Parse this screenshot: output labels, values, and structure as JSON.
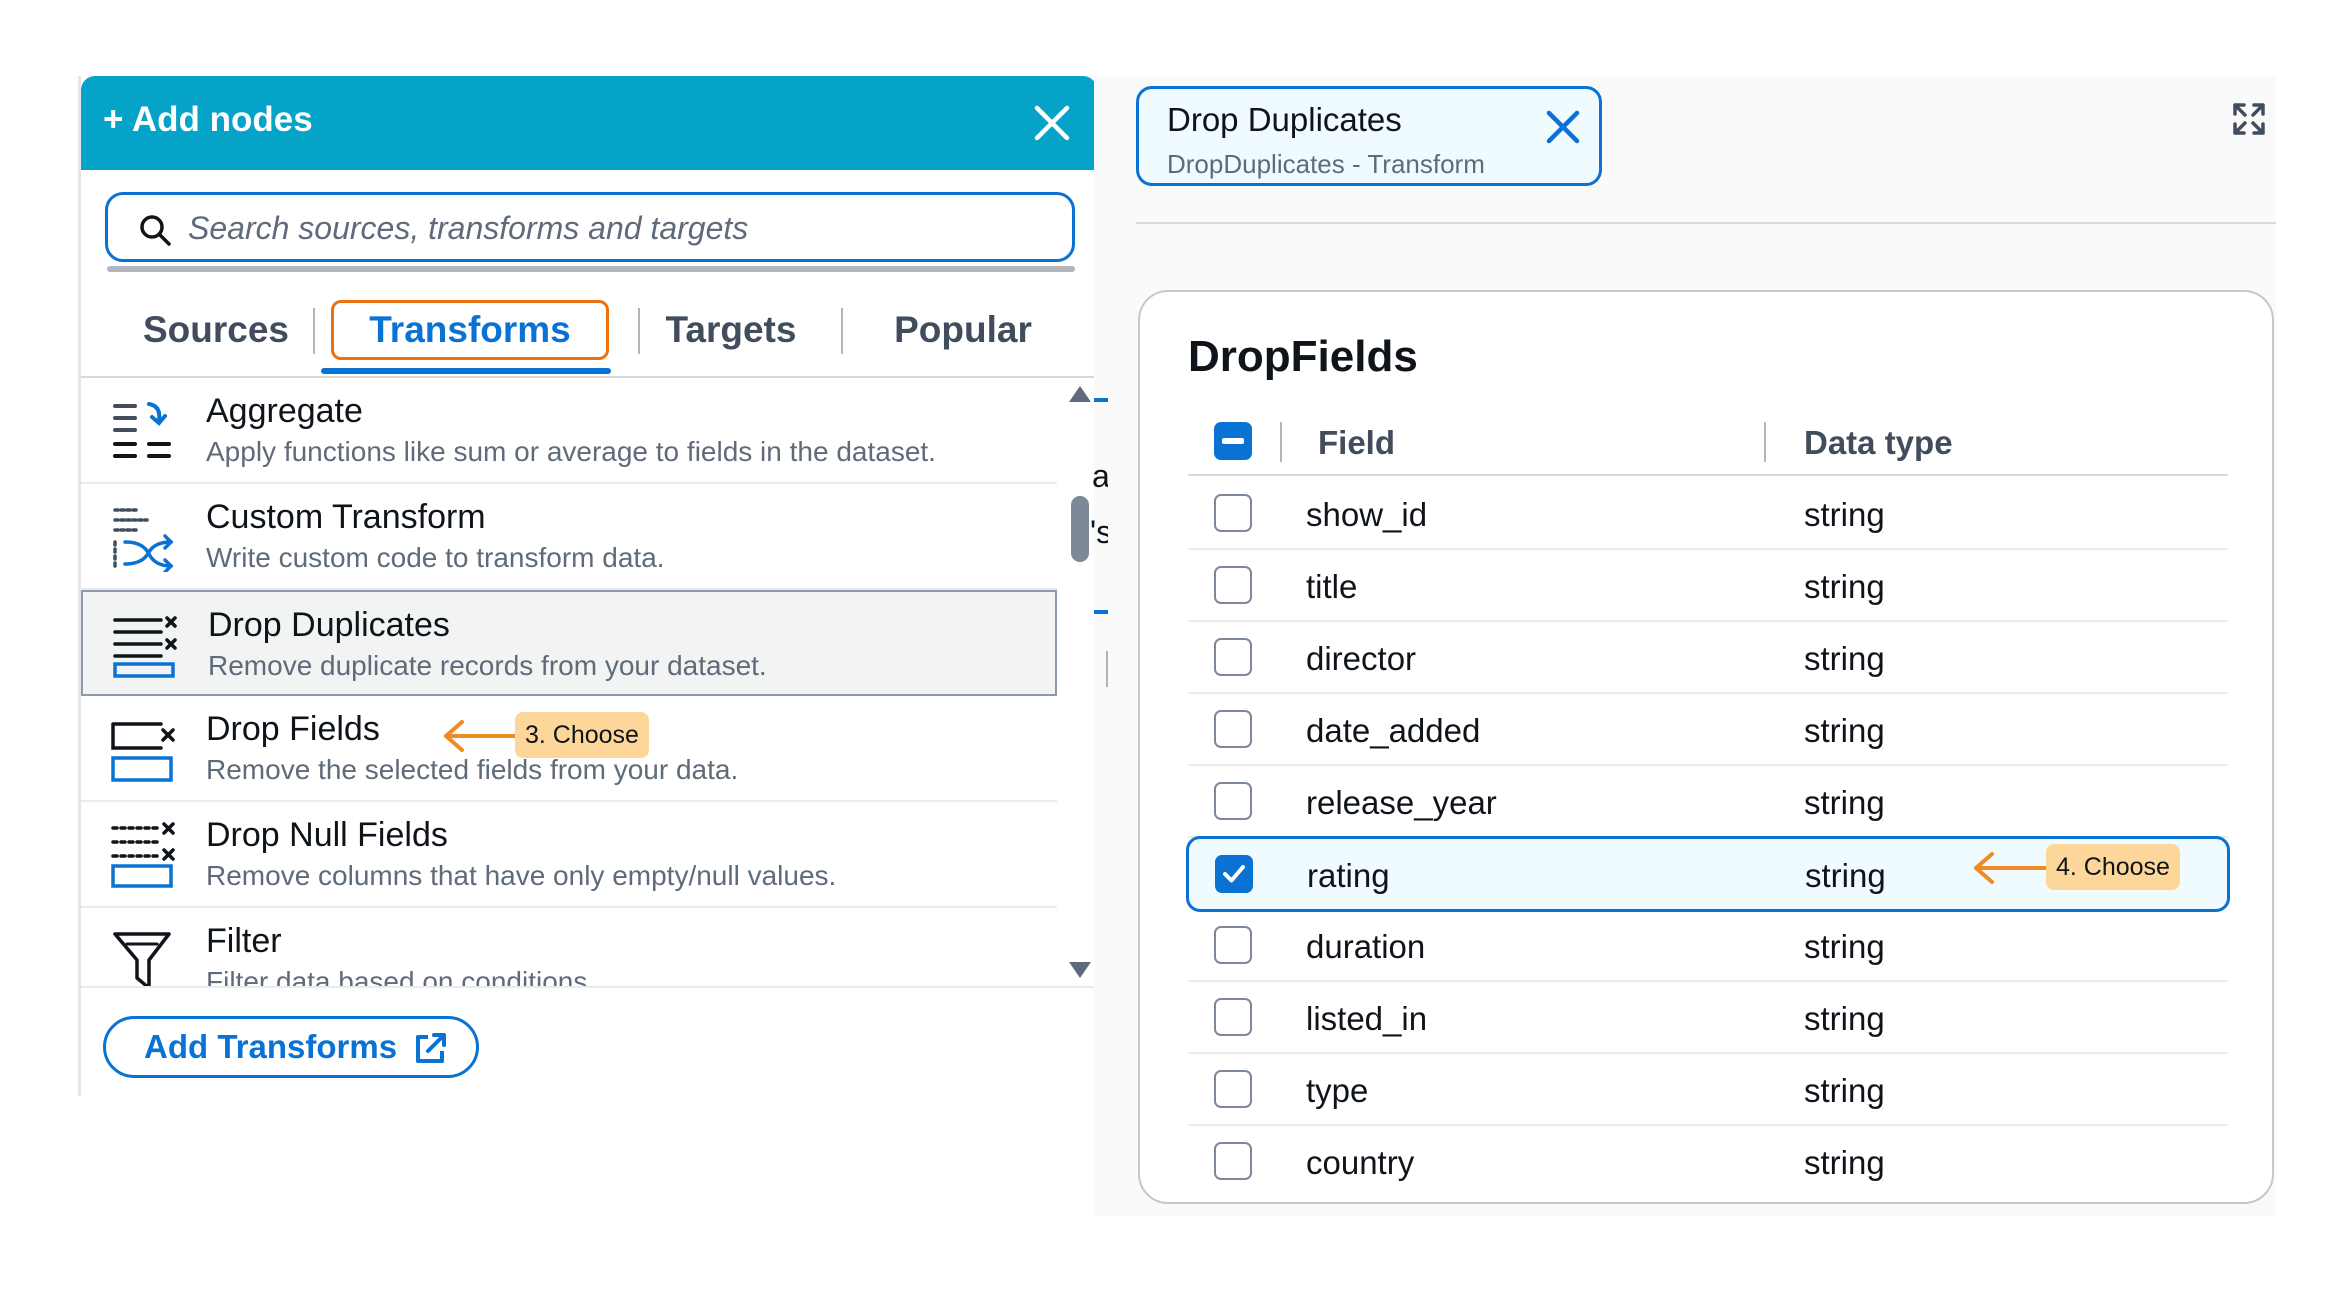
{
  "left_panel": {
    "title": "+ Add nodes",
    "search_placeholder": "Search sources, transforms and targets",
    "tabs": [
      "Sources",
      "Transforms",
      "Targets",
      "Popular"
    ],
    "active_tab": "Transforms",
    "items": [
      {
        "name": "Aggregate",
        "desc": "Apply functions like sum or average to fields in the dataset.",
        "icon": "aggregate-icon"
      },
      {
        "name": "Custom Transform",
        "desc": "Write custom code to transform data.",
        "icon": "custom-transform-icon"
      },
      {
        "name": "Drop Duplicates",
        "desc": "Remove duplicate records from your dataset.",
        "icon": "drop-duplicates-icon"
      },
      {
        "name": "Drop Fields",
        "desc": "Remove the selected fields from your data.",
        "icon": "drop-fields-icon"
      },
      {
        "name": "Drop Null Fields",
        "desc": "Remove columns that have only empty/null values.",
        "icon": "drop-null-fields-icon"
      },
      {
        "name": "Filter",
        "desc": "Filter data based on conditions.",
        "icon": "filter-icon"
      }
    ],
    "add_button": "Add Transforms"
  },
  "callouts": {
    "step3": "3. Choose",
    "step4": "4. Choose"
  },
  "canvas_sliver": {
    "char_a": "a",
    "char_s": "'s"
  },
  "right_panel": {
    "node_title": "Drop Duplicates",
    "node_subtitle": "DropDuplicates - Transform",
    "card_title": "DropFields",
    "col_field": "Field",
    "col_type": "Data type",
    "fields": [
      {
        "name": "show_id",
        "type": "string",
        "checked": false
      },
      {
        "name": "title",
        "type": "string",
        "checked": false
      },
      {
        "name": "director",
        "type": "string",
        "checked": false
      },
      {
        "name": "date_added",
        "type": "string",
        "checked": false
      },
      {
        "name": "release_year",
        "type": "string",
        "checked": false
      },
      {
        "name": "rating",
        "type": "string",
        "checked": true
      },
      {
        "name": "duration",
        "type": "string",
        "checked": false
      },
      {
        "name": "listed_in",
        "type": "string",
        "checked": false
      },
      {
        "name": "type",
        "type": "string",
        "checked": false
      },
      {
        "name": "country",
        "type": "string",
        "checked": false
      }
    ]
  },
  "colors": {
    "header": "#06a3c9",
    "accent": "#0972d3",
    "highlight_tab": "#ec7211",
    "callout_bg": "#fdd79a",
    "callout_arrow": "#f08a24"
  }
}
